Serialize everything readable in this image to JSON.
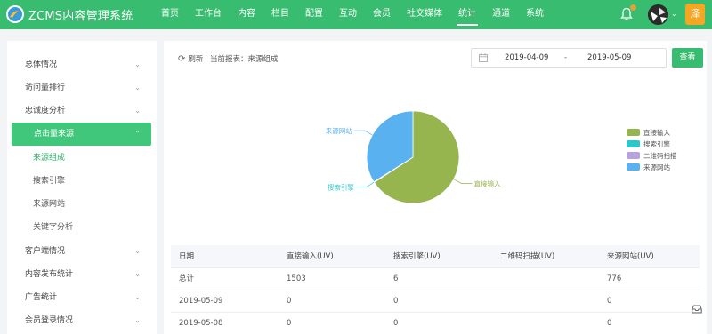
{
  "header": {
    "app_name": "ZCMS内容管理系统",
    "nav": [
      "首页",
      "工作台",
      "内容",
      "栏目",
      "配置",
      "互动",
      "会员",
      "社交媒体",
      "统计",
      "通道",
      "系统"
    ],
    "active_nav": "统计",
    "user_badge": "泽",
    "colors": {
      "header": "#38bd70",
      "accent": "#41c77b",
      "badge": "#f5a623"
    }
  },
  "sidebar": {
    "items": [
      {
        "label": "总体情况"
      },
      {
        "label": "访问量排行"
      },
      {
        "label": "忠诚度分析"
      },
      {
        "label": "点击量来源",
        "expanded": true
      },
      {
        "label": "来源组成",
        "sub": true,
        "current": true
      },
      {
        "label": "搜索引擎",
        "sub": true
      },
      {
        "label": "来源网站",
        "sub": true
      },
      {
        "label": "关键字分析",
        "sub": true
      },
      {
        "label": "客户端情况"
      },
      {
        "label": "内容发布统计"
      },
      {
        "label": "广告统计"
      },
      {
        "label": "会员登录情况"
      }
    ]
  },
  "toolbar": {
    "refresh_label": "刷新",
    "report_label": "当前报表：来源组成",
    "date_start": "2019-04-09",
    "date_sep": "-",
    "date_end": "2019-05-09",
    "query_label": "查看",
    "icons": [
      "refresh-icon",
      "calendar-icon"
    ]
  },
  "chart_data": {
    "type": "pie",
    "slices": [
      {
        "name": "直接输入",
        "value": 1503,
        "color": "#96b54e"
      },
      {
        "name": "搜索引擎",
        "value": 6,
        "color": "#2ec7c9"
      },
      {
        "name": "二维码扫描",
        "value": 0,
        "color": "#b6a2de"
      },
      {
        "name": "来源网站",
        "value": 776,
        "color": "#5ab1ef"
      }
    ],
    "labels_shown": [
      "来源网站",
      "搜索引擎",
      "直接输入"
    ],
    "legend": [
      "直接输入",
      "搜索引擎",
      "二维码扫描",
      "来源网站"
    ],
    "legend_placement": "right"
  },
  "table": {
    "headers": [
      "日期",
      "直接输入(UV)",
      "搜索引擎(UV)",
      "二维码扫描(UV)",
      "来源网站(UV)"
    ],
    "rows": [
      [
        "总计",
        "1503",
        "6",
        "",
        "776"
      ],
      [
        "2019-05-09",
        "0",
        "0",
        "",
        "0"
      ],
      [
        "2019-05-08",
        "0",
        "0",
        "",
        "0"
      ]
    ]
  }
}
